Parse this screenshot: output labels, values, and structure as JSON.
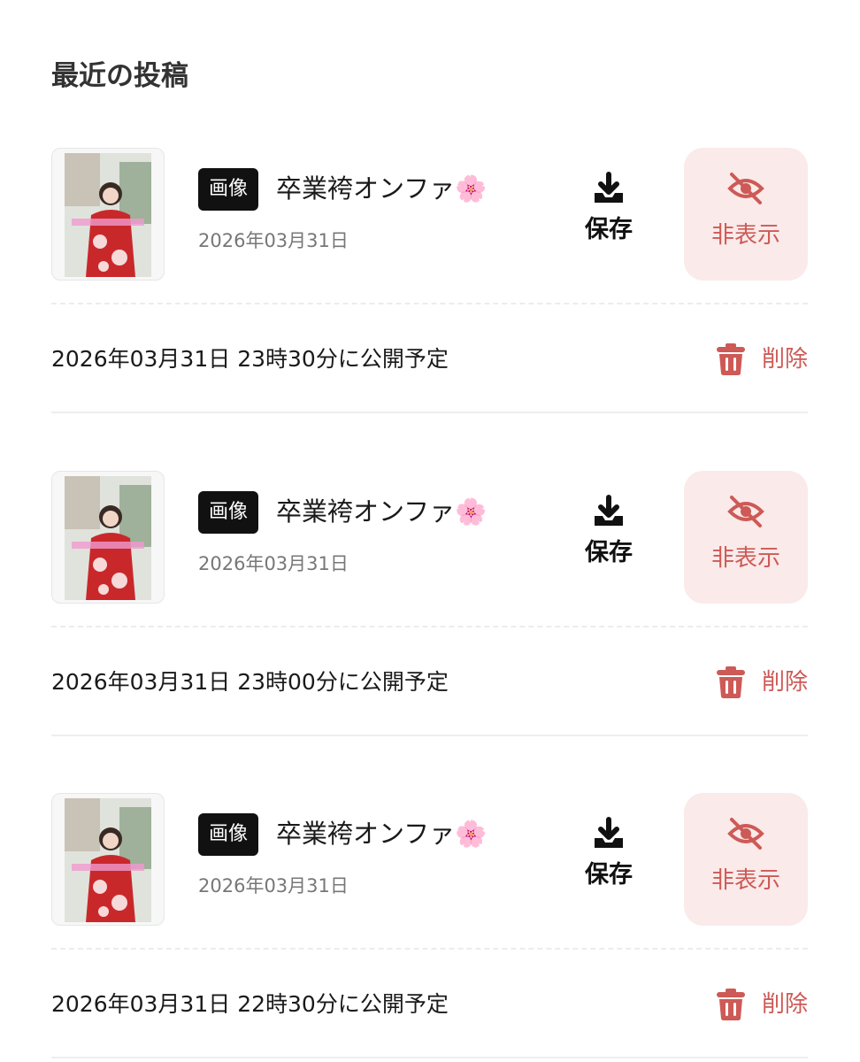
{
  "section_title": "最近の投稿",
  "colors": {
    "accent": "#cd5a56",
    "hide_bg": "#faeaea",
    "badge_bg": "#111111"
  },
  "posts": [
    {
      "badge": "画像",
      "title": "卒業袴オンファ🌸",
      "date": "2026年03月31日",
      "save_label": "保存",
      "hide_label": "非表示",
      "schedule": "2026年03月31日 23時30分に公開予定",
      "delete_label": "削除",
      "thumb_icon": "photo-thumbnail"
    },
    {
      "badge": "画像",
      "title": "卒業袴オンファ🌸",
      "date": "2026年03月31日",
      "save_label": "保存",
      "hide_label": "非表示",
      "schedule": "2026年03月31日 23時00分に公開予定",
      "delete_label": "削除",
      "thumb_icon": "photo-thumbnail"
    },
    {
      "badge": "画像",
      "title": "卒業袴オンファ🌸",
      "date": "2026年03月31日",
      "save_label": "保存",
      "hide_label": "非表示",
      "schedule": "2026年03月31日 22時30分に公開予定",
      "delete_label": "削除",
      "thumb_icon": "photo-thumbnail"
    }
  ]
}
